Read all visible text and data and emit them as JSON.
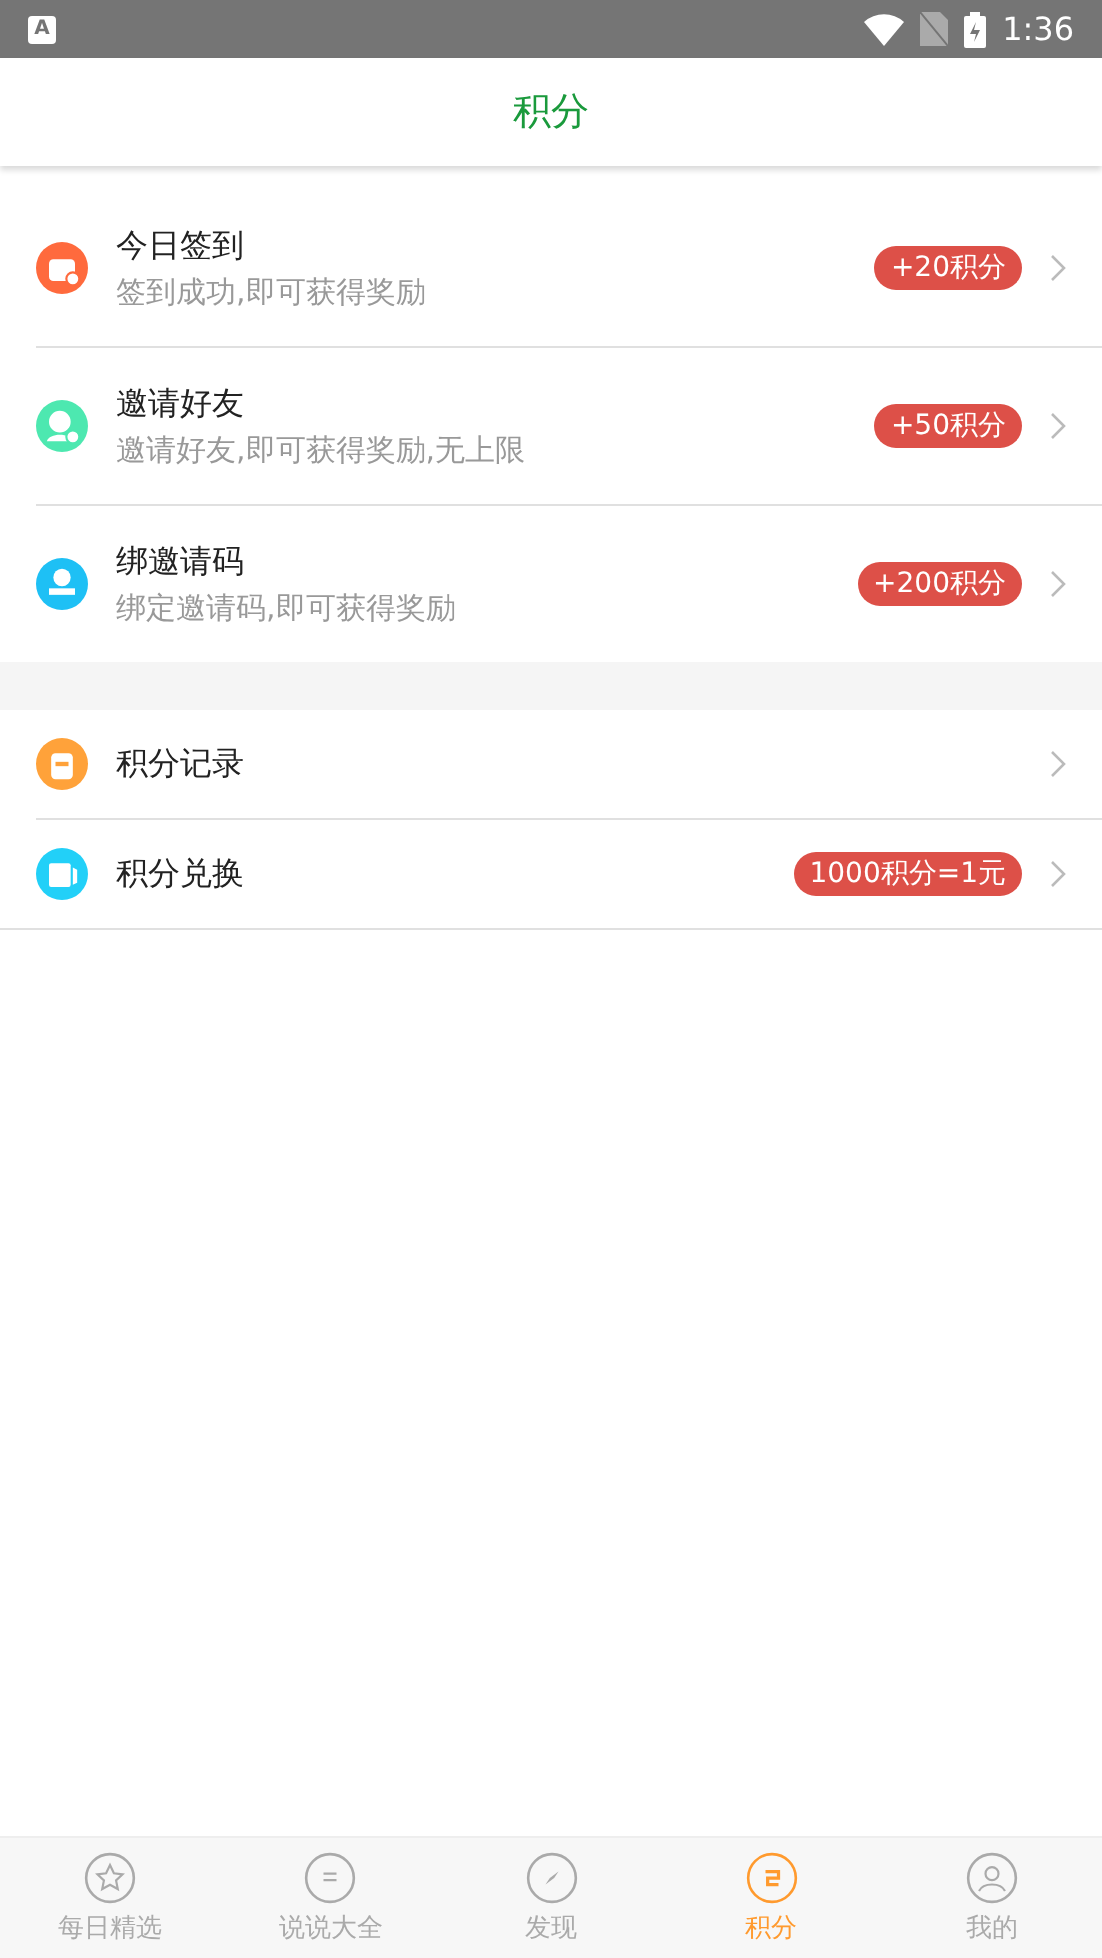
{
  "status_bar": {
    "notification": "A",
    "time": "1:36"
  },
  "header": {
    "title": "积分"
  },
  "groups": [
    {
      "items": [
        {
          "color": "#ff6a3d",
          "title": "今日签到",
          "subtitle": "签到成功,即可获得奖励",
          "badge": "+20积分"
        },
        {
          "color": "#4de8b0",
          "title": "邀请好友",
          "subtitle": "邀请好友,即可获得奖励,无上限",
          "badge": "+50积分"
        },
        {
          "color": "#1ec0f5",
          "title": "绑邀请码",
          "subtitle": "绑定邀请码,即可获得奖励",
          "badge": "+200积分"
        }
      ]
    },
    {
      "items": [
        {
          "color": "#ffa23a",
          "title": "积分记录"
        },
        {
          "color": "#22d0f8",
          "title": "积分兑换",
          "badge": "1000积分=1元"
        }
      ]
    }
  ],
  "bottom_nav": [
    {
      "label": "每日精选",
      "selected": false
    },
    {
      "label": "说说大全",
      "selected": false
    },
    {
      "label": "发现",
      "selected": false
    },
    {
      "label": "积分",
      "selected": true
    },
    {
      "label": "我的",
      "selected": false
    }
  ]
}
